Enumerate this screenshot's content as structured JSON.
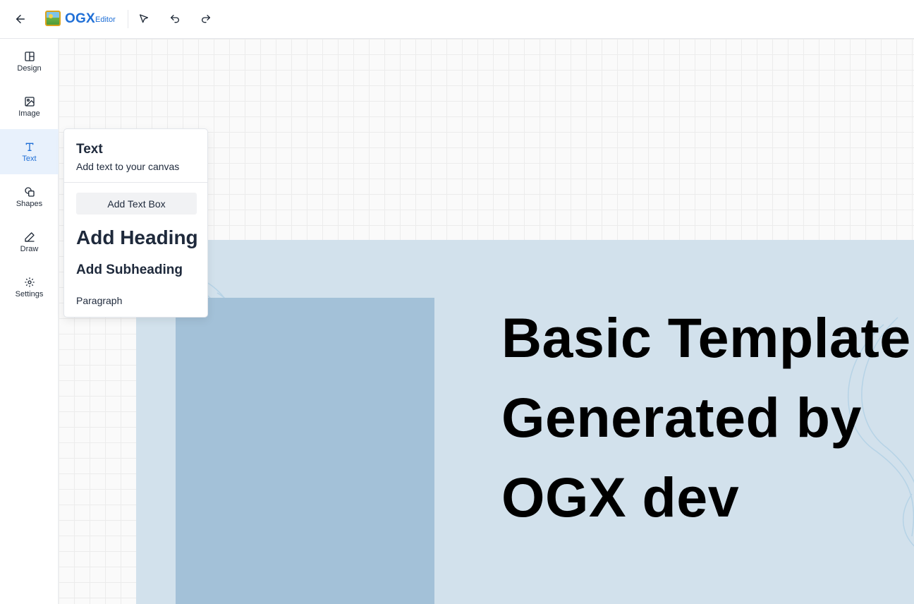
{
  "app": {
    "name": "OGX",
    "subtitle": "Editor"
  },
  "toolbar": {
    "back_icon": "arrow-left-icon",
    "select_icon": "cursor-icon",
    "undo_icon": "undo-icon",
    "redo_icon": "redo-icon"
  },
  "sidebar": {
    "items": [
      {
        "label": "Design",
        "icon": "layout-icon"
      },
      {
        "label": "Image",
        "icon": "image-icon"
      },
      {
        "label": "Text",
        "icon": "text-icon",
        "active": true
      },
      {
        "label": "Shapes",
        "icon": "shapes-icon"
      },
      {
        "label": "Draw",
        "icon": "pencil-icon"
      },
      {
        "label": "Settings",
        "icon": "gear-icon"
      }
    ]
  },
  "text_panel": {
    "title": "Text",
    "description": "Add text to your canvas",
    "add_text_box": "Add Text Box",
    "add_heading": "Add Heading",
    "add_subheading": "Add Subheading",
    "paragraph": "Paragraph"
  },
  "canvas": {
    "title": "Basic Template\nGenerated by\nOGX dev"
  },
  "colors": {
    "accent": "#1f6fd6",
    "active_bg": "#e8f1fc",
    "design_bg": "#d2e1ec",
    "image_block": "#a3c1d8"
  }
}
